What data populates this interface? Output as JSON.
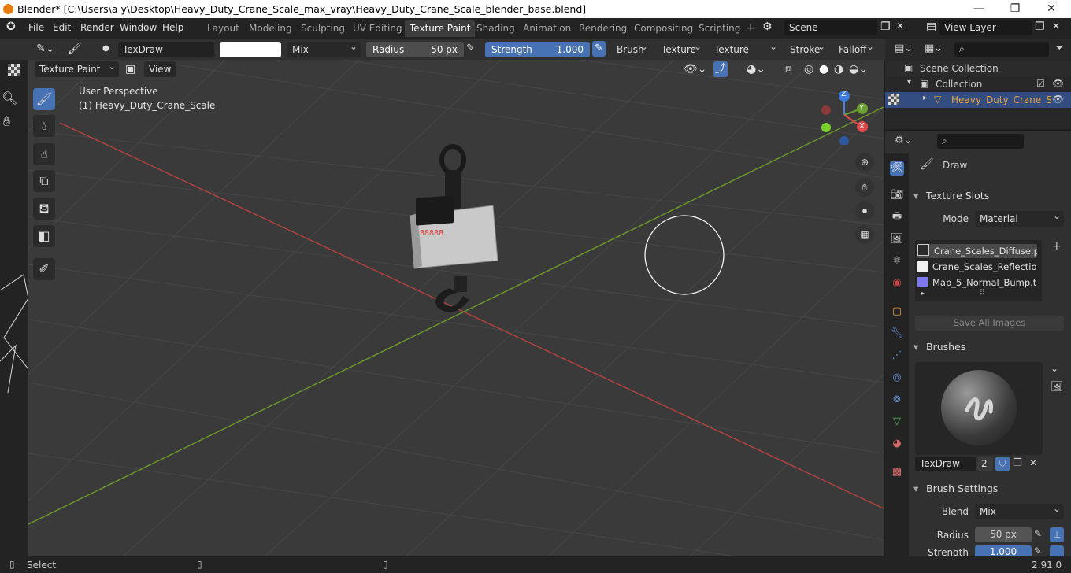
{
  "window": {
    "title": "Blender* [C:\\Users\\a y\\Desktop\\Heavy_Duty_Crane_Scale_max_vray\\Heavy_Duty_Crane_Scale_blender_base.blend]",
    "minimize": "—",
    "maximize": "❐",
    "close": "✕"
  },
  "menus": [
    "File",
    "Edit",
    "Render",
    "Window",
    "Help"
  ],
  "workspaces": [
    "Layout",
    "Modeling",
    "Sculpting",
    "UV Editing",
    "Texture Paint",
    "Shading",
    "Animation",
    "Rendering",
    "Compositing",
    "Scripting"
  ],
  "workspace_add": "+",
  "active_workspace": "Texture Paint",
  "scene": {
    "name": "Scene",
    "view_layer": "View Layer"
  },
  "toolbar": {
    "brush_name": "TexDraw",
    "blend": "Mix",
    "radius_label": "Radius",
    "radius_value": "50 px",
    "strength_label": "Strength",
    "strength_value": "1.000",
    "menus": [
      "Brush",
      "Texture",
      "Texture Mask",
      "Stroke",
      "Falloff"
    ]
  },
  "viewhdr": {
    "mode": "Texture Paint",
    "view": "View"
  },
  "viewport": {
    "perspective": "User Perspective",
    "object": "(1) Heavy_Duty_Crane_Scale",
    "display_digits": "88888",
    "axes": {
      "z": "Z",
      "y": "Y",
      "x": "X"
    }
  },
  "outliner": {
    "root": "Scene Collection",
    "collection": "Collection",
    "object": "Heavy_Duty_Crane_S"
  },
  "properties": {
    "tool_name": "Draw",
    "texture_slots": {
      "title": "Texture Slots",
      "mode_label": "Mode",
      "mode_value": "Material",
      "slots": [
        {
          "name": "Crane_Scales_Diffuse.p...",
          "color": "#2a2a2a"
        },
        {
          "name": "Crane_Scales_Reflectio...",
          "color": "#f0f0f0"
        },
        {
          "name": "Map_5_Normal_Bump.t...",
          "color": "#7b78f0"
        }
      ],
      "add": "+",
      "save_all": "Save All Images"
    },
    "brushes": {
      "title": "Brushes",
      "brush": "TexDraw",
      "users": "2"
    },
    "brush_settings": {
      "title": "Brush Settings",
      "blend_label": "Blend",
      "blend_value": "Mix",
      "radius_label": "Radius",
      "radius_value": "50 px",
      "strength_label": "Strength",
      "strength_value": "1.000"
    }
  },
  "status": {
    "left": "Select",
    "version": "2.91.0"
  },
  "colors": {
    "accent": "#4772b3",
    "active_object": "#e8a142",
    "x_axis": "#c94b4b",
    "y_axis": "#6b9f2a"
  }
}
